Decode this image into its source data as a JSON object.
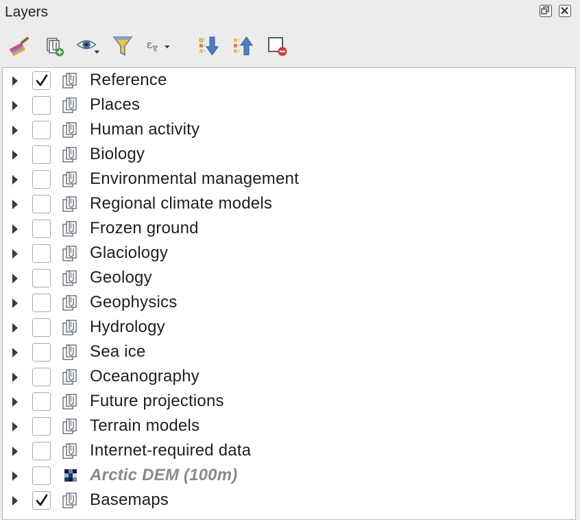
{
  "panel": {
    "title": "Layers"
  },
  "window_controls": [
    {
      "name": "float-button",
      "icon": "restore-icon"
    },
    {
      "name": "close-button",
      "icon": "close-icon"
    }
  ],
  "toolbar": [
    {
      "name": "style-manager-button",
      "icon": "paintbrush-icon"
    },
    {
      "name": "add-group-button",
      "icon": "add-group-icon"
    },
    {
      "name": "manage-visibility-button",
      "icon": "eye-icon"
    },
    {
      "name": "filter-legend-button",
      "icon": "funnel-icon"
    },
    {
      "name": "filter-by-expression-button",
      "icon": "epsilon-filter-icon"
    },
    {
      "name": "expand-all-button",
      "icon": "expand-all-icon"
    },
    {
      "name": "collapse-all-button",
      "icon": "collapse-all-icon"
    },
    {
      "name": "remove-layer-button",
      "icon": "remove-layer-icon"
    }
  ],
  "layers": [
    {
      "label": "Reference",
      "checked": true,
      "type": "group"
    },
    {
      "label": "Places",
      "checked": false,
      "type": "group"
    },
    {
      "label": "Human activity",
      "checked": false,
      "type": "group"
    },
    {
      "label": "Biology",
      "checked": false,
      "type": "group"
    },
    {
      "label": "Environmental management",
      "checked": false,
      "type": "group"
    },
    {
      "label": "Regional climate models",
      "checked": false,
      "type": "group"
    },
    {
      "label": "Frozen ground",
      "checked": false,
      "type": "group"
    },
    {
      "label": "Glaciology",
      "checked": false,
      "type": "group"
    },
    {
      "label": "Geology",
      "checked": false,
      "type": "group"
    },
    {
      "label": "Geophysics",
      "checked": false,
      "type": "group"
    },
    {
      "label": "Hydrology",
      "checked": false,
      "type": "group"
    },
    {
      "label": "Sea ice",
      "checked": false,
      "type": "group"
    },
    {
      "label": "Oceanography",
      "checked": false,
      "type": "group"
    },
    {
      "label": "Future projections",
      "checked": false,
      "type": "group"
    },
    {
      "label": "Terrain models",
      "checked": false,
      "type": "group"
    },
    {
      "label": "Internet-required data",
      "checked": false,
      "type": "group"
    },
    {
      "label": "Arctic DEM (100m)",
      "checked": false,
      "type": "raster",
      "disabled": true
    },
    {
      "label": "Basemaps",
      "checked": true,
      "type": "group"
    }
  ]
}
